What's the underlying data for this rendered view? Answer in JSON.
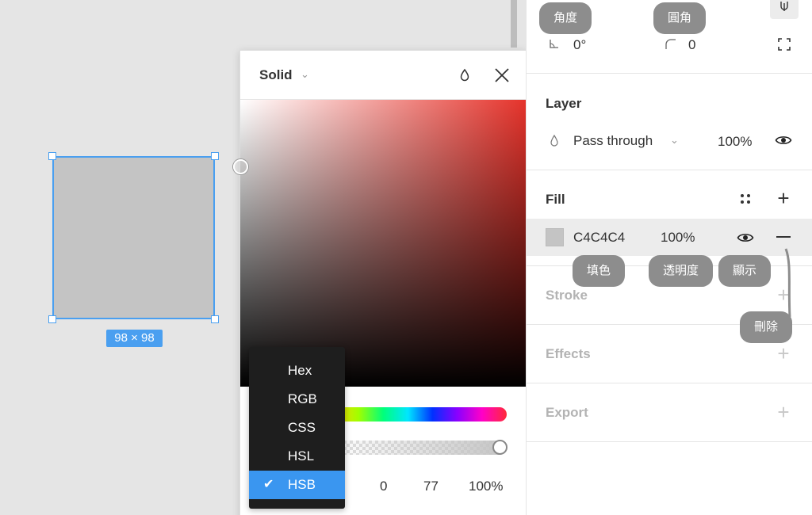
{
  "canvas": {
    "selection_size": "98 × 98",
    "shape_color": "#c4c4c4",
    "selection_color": "#4a9ff0"
  },
  "color_picker": {
    "fill_type": "Solid",
    "icons": {
      "dropdown": "chevron-down-icon",
      "eyedropper": "droplet-icon",
      "close": "close-icon"
    },
    "hue_color": "#e5322a",
    "values": [
      "0",
      "77",
      "100%"
    ],
    "format_menu": {
      "items": [
        "Hex",
        "RGB",
        "CSS",
        "HSL",
        "HSB"
      ],
      "selected": "HSB",
      "selected_color": "#3a96f0"
    }
  },
  "panel": {
    "transform": {
      "angle_value": "0°",
      "radius_value": "0"
    },
    "layer": {
      "title": "Layer",
      "blend_mode": "Pass through",
      "opacity": "100%"
    },
    "fill": {
      "title": "Fill",
      "hex": "C4C4C4",
      "opacity": "100%",
      "swatch_color": "#c4c4c4"
    },
    "stroke": {
      "title": "Stroke"
    },
    "effects": {
      "title": "Effects"
    },
    "export": {
      "title": "Export"
    }
  },
  "annotations": {
    "angle": "角度",
    "radius": "圓角",
    "fill_color": "填色",
    "opacity": "透明度",
    "visibility": "顯示",
    "remove": "刪除"
  }
}
